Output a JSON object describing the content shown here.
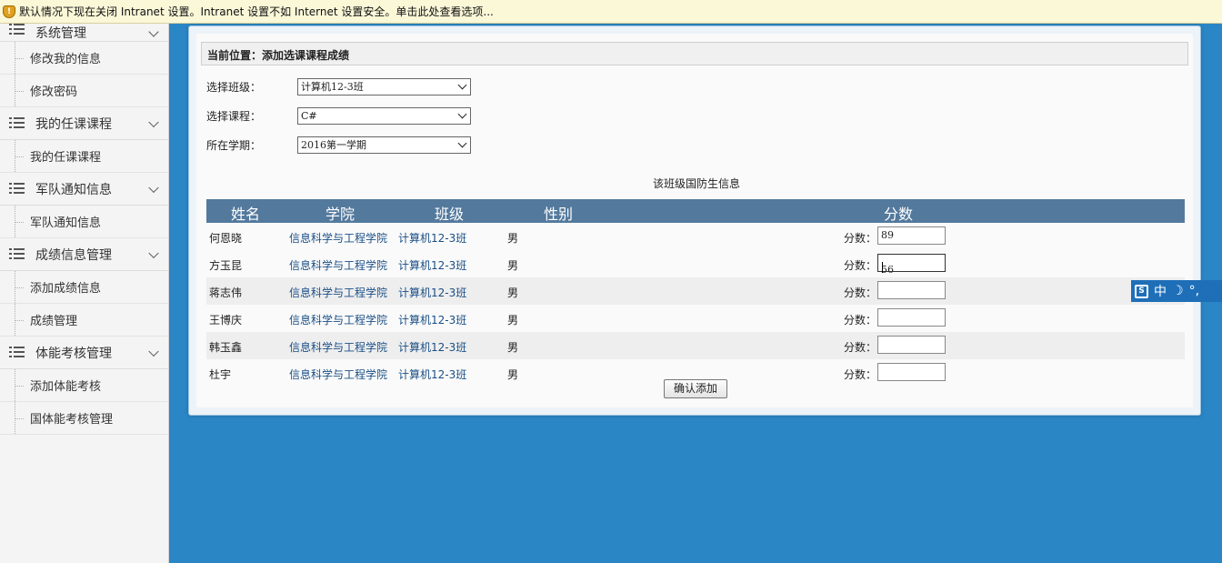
{
  "infobar": {
    "text": "默认情况下现在关闭 Intranet 设置。Intranet 设置不如 Internet 设置安全。单击此处查看选项..."
  },
  "sidebar": {
    "groups": [
      {
        "label": "系统管理",
        "items": [
          "修改我的信息",
          "修改密码"
        ]
      },
      {
        "label": "我的任课课程",
        "items": [
          "我的任课课程"
        ]
      },
      {
        "label": "军队通知信息",
        "items": [
          "军队通知信息"
        ]
      },
      {
        "label": "成绩信息管理",
        "items": [
          "添加成绩信息",
          "成绩管理"
        ]
      },
      {
        "label": "体能考核管理",
        "items": [
          "添加体能考核",
          "国体能考核管理"
        ]
      }
    ]
  },
  "breadcrumb": "当前位置：添加选课课程成绩",
  "form": {
    "class_label": "选择班级：",
    "class_value": "计算机12-3班",
    "course_label": "选择课程：",
    "course_value": "C#",
    "term_label": "所在学期：",
    "term_value": "2016第一学期"
  },
  "section_title": "该班级国防生信息",
  "table": {
    "headers": [
      "姓名",
      "学院",
      "班级",
      "性别",
      "分数"
    ],
    "score_label": "分数：",
    "rows": [
      {
        "name": "何恩晓",
        "dept": "信息科学与工程学院",
        "cls": "计算机12-3班",
        "gender": "男",
        "score": "89"
      },
      {
        "name": "方玉昆",
        "dept": "信息科学与工程学院",
        "cls": "计算机12-3班",
        "gender": "男",
        "score": "56"
      },
      {
        "name": "蒋志伟",
        "dept": "信息科学与工程学院",
        "cls": "计算机12-3班",
        "gender": "男",
        "score": ""
      },
      {
        "name": "王博庆",
        "dept": "信息科学与工程学院",
        "cls": "计算机12-3班",
        "gender": "男",
        "score": ""
      },
      {
        "name": "韩玉鑫",
        "dept": "信息科学与工程学院",
        "cls": "计算机12-3班",
        "gender": "男",
        "score": ""
      },
      {
        "name": "杜宇",
        "dept": "信息科学与工程学院",
        "cls": "计算机12-3班",
        "gender": "男",
        "score": ""
      }
    ]
  },
  "submit_label": "确认添加",
  "ime": {
    "mode": "中",
    "punct": "°,"
  },
  "colors": {
    "background": "#2b86c5",
    "table_header": "#53799d",
    "infobar": "#fbf8d8"
  }
}
